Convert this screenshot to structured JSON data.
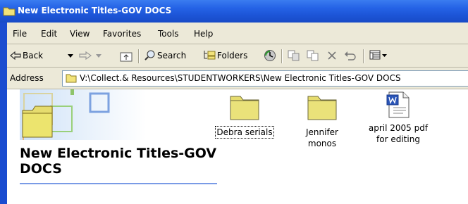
{
  "window": {
    "title": "New Electronic Titles-GOV DOCS"
  },
  "menu": [
    "File",
    "Edit",
    "View",
    "Favorites",
    "Tools",
    "Help"
  ],
  "toolbar": {
    "back": "Back",
    "search": "Search",
    "folders": "Folders"
  },
  "address": {
    "label": "Address",
    "path": "V:\\Collect.& Resources\\STUDENTWORKERS\\New Electronic Titles-GOV DOCS"
  },
  "panel": {
    "title": "New Electronic Titles-GOV DOCS"
  },
  "items": [
    {
      "name": "Debra serials",
      "type": "folder",
      "selected": true
    },
    {
      "name": "Jennifer monos",
      "type": "folder",
      "selected": false
    },
    {
      "name": "april 2005 pdf for editing",
      "type": "word-document",
      "selected": false
    }
  ],
  "colors": {
    "titlebar": "#2563e6",
    "chrome": "#ece9d8",
    "folder": "#e6dc6e",
    "accent": "#7a9be6"
  }
}
